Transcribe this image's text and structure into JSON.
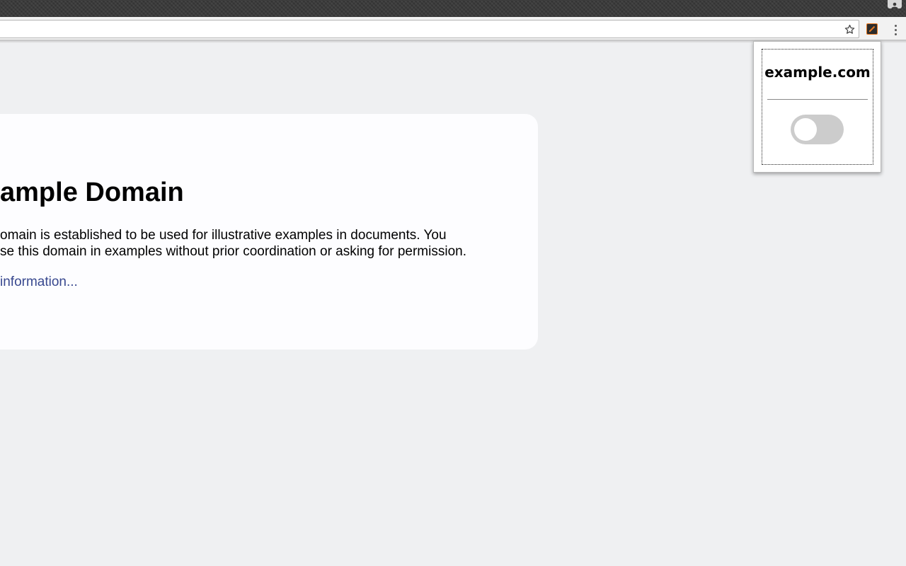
{
  "browser": {
    "address_bar": {
      "value": ""
    },
    "toolbar_icons": [
      "star-icon",
      "extension-icon",
      "menu-icon",
      "profile-icon"
    ]
  },
  "page": {
    "heading": "ample Domain",
    "paragraph_lines": [
      "omain is established to be used for illustrative examples in documents. You",
      "se this domain in examples without prior coordination or asking for permission."
    ],
    "link_text": "information..."
  },
  "popup": {
    "title": "example.com",
    "toggle": {
      "state": "off"
    }
  },
  "colors": {
    "page_background": "#eff0f2",
    "card_background": "#fdfdff",
    "link": "#38488f",
    "toggle_track": "#cccccc",
    "extension_accent": "#e8771e"
  }
}
